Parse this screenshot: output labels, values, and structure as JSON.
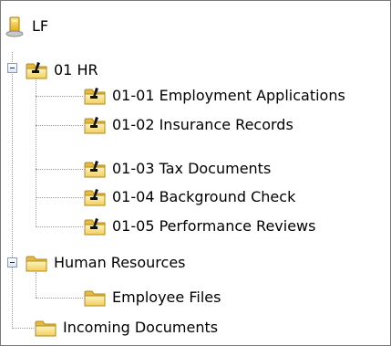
{
  "tree": {
    "root": {
      "label": "LF",
      "icon": "repository-icon"
    },
    "nodes": [
      {
        "label": "01 HR",
        "icon": "record-folder-icon",
        "expanded": true,
        "children": [
          {
            "label": "01-01 Employment Applications",
            "icon": "record-folder-icon"
          },
          {
            "label": "01-02 Insurance Records",
            "icon": "record-folder-icon"
          },
          {
            "label": "01-03 Tax Documents",
            "icon": "record-folder-icon"
          },
          {
            "label": "01-04 Background Check",
            "icon": "record-folder-icon"
          },
          {
            "label": "01-05 Performance Reviews",
            "icon": "record-folder-icon"
          }
        ]
      },
      {
        "label": "Human Resources",
        "icon": "folder-icon",
        "expanded": true,
        "children": [
          {
            "label": "Employee Files",
            "icon": "folder-icon"
          }
        ]
      },
      {
        "label": "Incoming Documents",
        "icon": "folder-icon",
        "expanded": false,
        "children": []
      }
    ]
  },
  "colors": {
    "folder_yellow": "#f5d66b",
    "record_marker": "#111111",
    "repository_yellow": "#f3c62c"
  }
}
